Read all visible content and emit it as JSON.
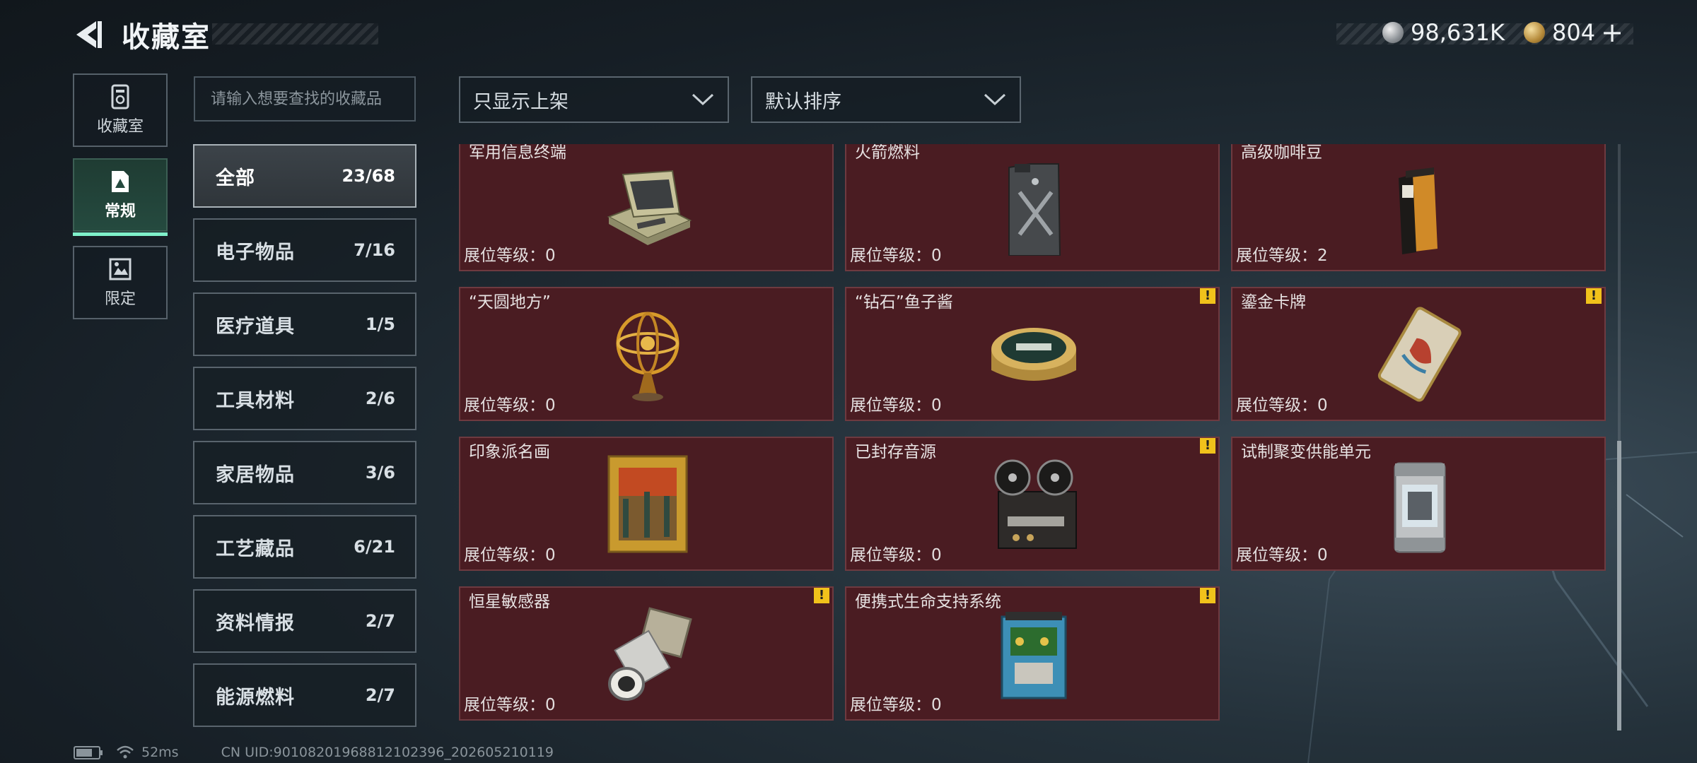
{
  "header": {
    "title": "收藏室",
    "currency_silver": "98,631K",
    "currency_gold": "804",
    "currency_plus": "+"
  },
  "side_tabs": [
    {
      "label": "收藏室",
      "icon": "collection-icon",
      "active": false
    },
    {
      "label": "常规",
      "icon": "regular-icon",
      "active": true
    },
    {
      "label": "限定",
      "icon": "limited-icon",
      "active": false
    }
  ],
  "search": {
    "placeholder": "请输入想要查找的收藏品",
    "value": ""
  },
  "categories": [
    {
      "name": "全部",
      "count": "23/68",
      "active": true
    },
    {
      "name": "电子物品",
      "count": "7/16"
    },
    {
      "name": "医疗道具",
      "count": "1/5"
    },
    {
      "name": "工具材料",
      "count": "2/6"
    },
    {
      "name": "家居物品",
      "count": "3/6"
    },
    {
      "name": "工艺藏品",
      "count": "6/21"
    },
    {
      "name": "资料情报",
      "count": "2/7"
    },
    {
      "name": "能源燃料",
      "count": "2/7"
    }
  ],
  "filters": {
    "show_filter": "只显示上架",
    "sort": "默认排序"
  },
  "items": [
    {
      "name": "军用信息终端",
      "level_label": "展位等级：0",
      "warning": false,
      "icon": "terminal-icon"
    },
    {
      "name": "火箭燃料",
      "level_label": "展位等级：0",
      "warning": false,
      "icon": "fuel-can-icon"
    },
    {
      "name": "高级咖啡豆",
      "level_label": "展位等级：2",
      "warning": false,
      "icon": "coffee-bag-icon"
    },
    {
      "name": "“天圆地方”",
      "level_label": "展位等级：0",
      "warning": false,
      "icon": "armillary-sphere-icon"
    },
    {
      "name": "“钻石”鱼子酱",
      "level_label": "展位等级：0",
      "warning": true,
      "icon": "caviar-tin-icon"
    },
    {
      "name": "鎏金卡牌",
      "level_label": "展位等级：0",
      "warning": true,
      "icon": "gold-card-icon"
    },
    {
      "name": "印象派名画",
      "level_label": "展位等级：0",
      "warning": false,
      "icon": "painting-icon"
    },
    {
      "name": "已封存音源",
      "level_label": "展位等级：0",
      "warning": true,
      "icon": "tape-recorder-icon"
    },
    {
      "name": "试制聚变供能单元",
      "level_label": "展位等级：0",
      "warning": false,
      "icon": "fusion-cell-icon"
    },
    {
      "name": "恒星敏感器",
      "level_label": "展位等级：0",
      "warning": true,
      "icon": "star-sensor-icon"
    },
    {
      "name": "便携式生命支持系统",
      "level_label": "展位等级：0",
      "warning": true,
      "icon": "life-support-icon"
    }
  ],
  "warning_mark": "!",
  "status_bar": {
    "ping": "52ms",
    "uid": "CN UID:90108201968812102396_202605210119"
  }
}
